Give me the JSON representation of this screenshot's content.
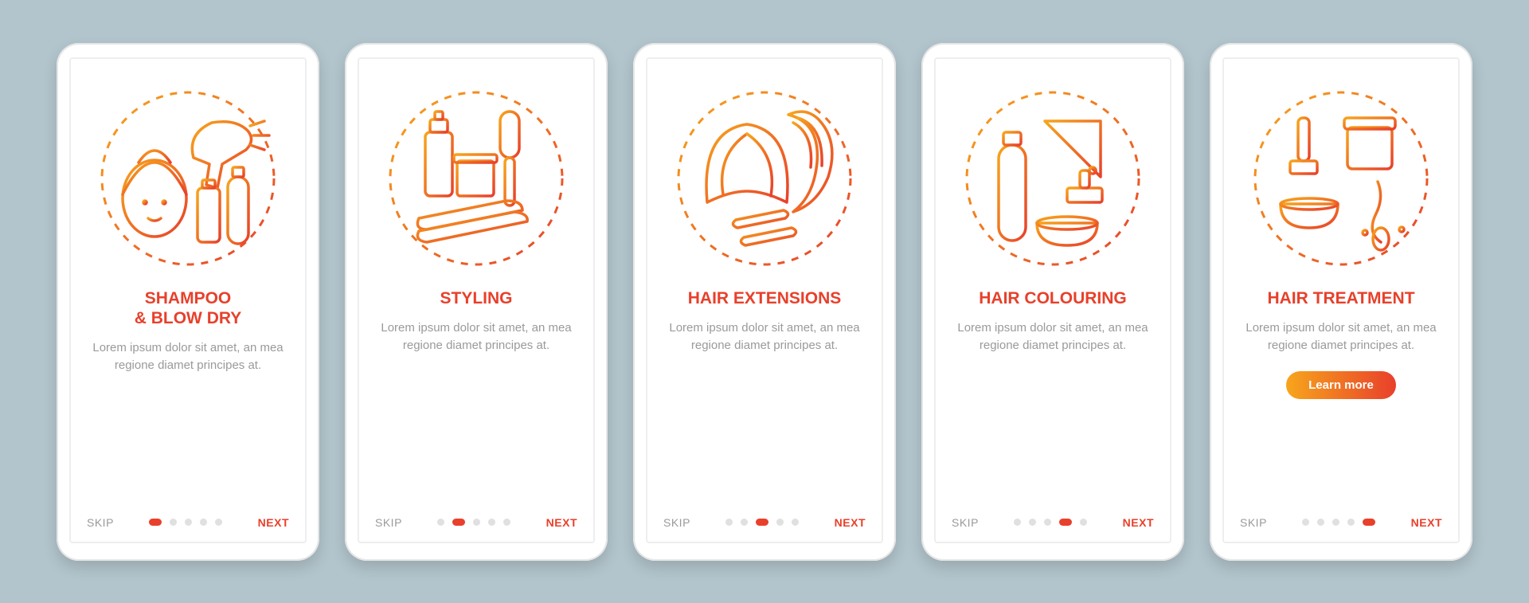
{
  "buttons": {
    "skip": "SKIP",
    "next": "NEXT",
    "learn_more": "Learn more"
  },
  "description": "Lorem ipsum dolor sit amet, an mea regione diamet principes at.",
  "screens": [
    {
      "title": "SHAMPOO\n& BLOW DRY",
      "icon": "shampoo-blow-dry-icon",
      "active_dot": 0,
      "has_learn_more": false
    },
    {
      "title": "STYLING",
      "icon": "styling-icon",
      "active_dot": 1,
      "has_learn_more": false
    },
    {
      "title": "HAIR EXTENSIONS",
      "icon": "hair-extensions-icon",
      "active_dot": 2,
      "has_learn_more": false
    },
    {
      "title": "HAIR COLOURING",
      "icon": "hair-colouring-icon",
      "active_dot": 3,
      "has_learn_more": false
    },
    {
      "title": "HAIR TREATMENT",
      "icon": "hair-treatment-icon",
      "active_dot": 4,
      "has_learn_more": true
    }
  ],
  "colors": {
    "accent": "#e8402b",
    "accent_light": "#f7a51c",
    "bg": "#b2c5cc",
    "muted": "#9a9a9a"
  }
}
